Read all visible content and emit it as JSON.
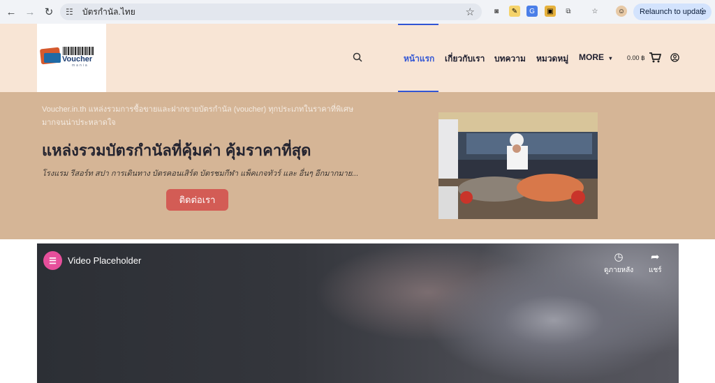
{
  "browser": {
    "url": "บัตรกำนัล.ไทย",
    "relaunch_label": "Relaunch to update"
  },
  "header": {
    "logo_text": "Voucher",
    "logo_sub": "mania",
    "menu": [
      {
        "label": "หน้าแรก"
      },
      {
        "label": "เกี่ยวกับเรา"
      },
      {
        "label": "บทความ"
      },
      {
        "label": "หมวดหมู่"
      },
      {
        "label": "MORE"
      }
    ],
    "cart_amount": "0.00 ฿"
  },
  "hero": {
    "intro_line1": "Voucher.in.th แหล่งรวมการซื้อขายและฝากขายบัตรกำนัล (voucher) ทุกประเภทในราคาที่พิเศษ",
    "intro_line2": "มากจนน่าประหลาดใจ",
    "title": "แหล่งรวมบัตรกำนัลที่คุ้มค่า คุ้มราคาที่สุด",
    "subtitle": "โรงแรม รีสอร์ท สปา การเดินทาง บัตรคอนเสิร์ต บัตรชมกีฬา แพ็คเกจทัวร์ และ อื่นๆ อีกมากมาย...",
    "button_label": "ติดต่อเรา"
  },
  "video": {
    "title": "Video Placeholder",
    "watch_later": "ดูภายหลัง",
    "share": "แชร์"
  },
  "colors": {
    "accent": "#3155d4",
    "header_bg": "#f8e5d5",
    "hero_bg": "#d5b596",
    "button": "#d35c55"
  }
}
